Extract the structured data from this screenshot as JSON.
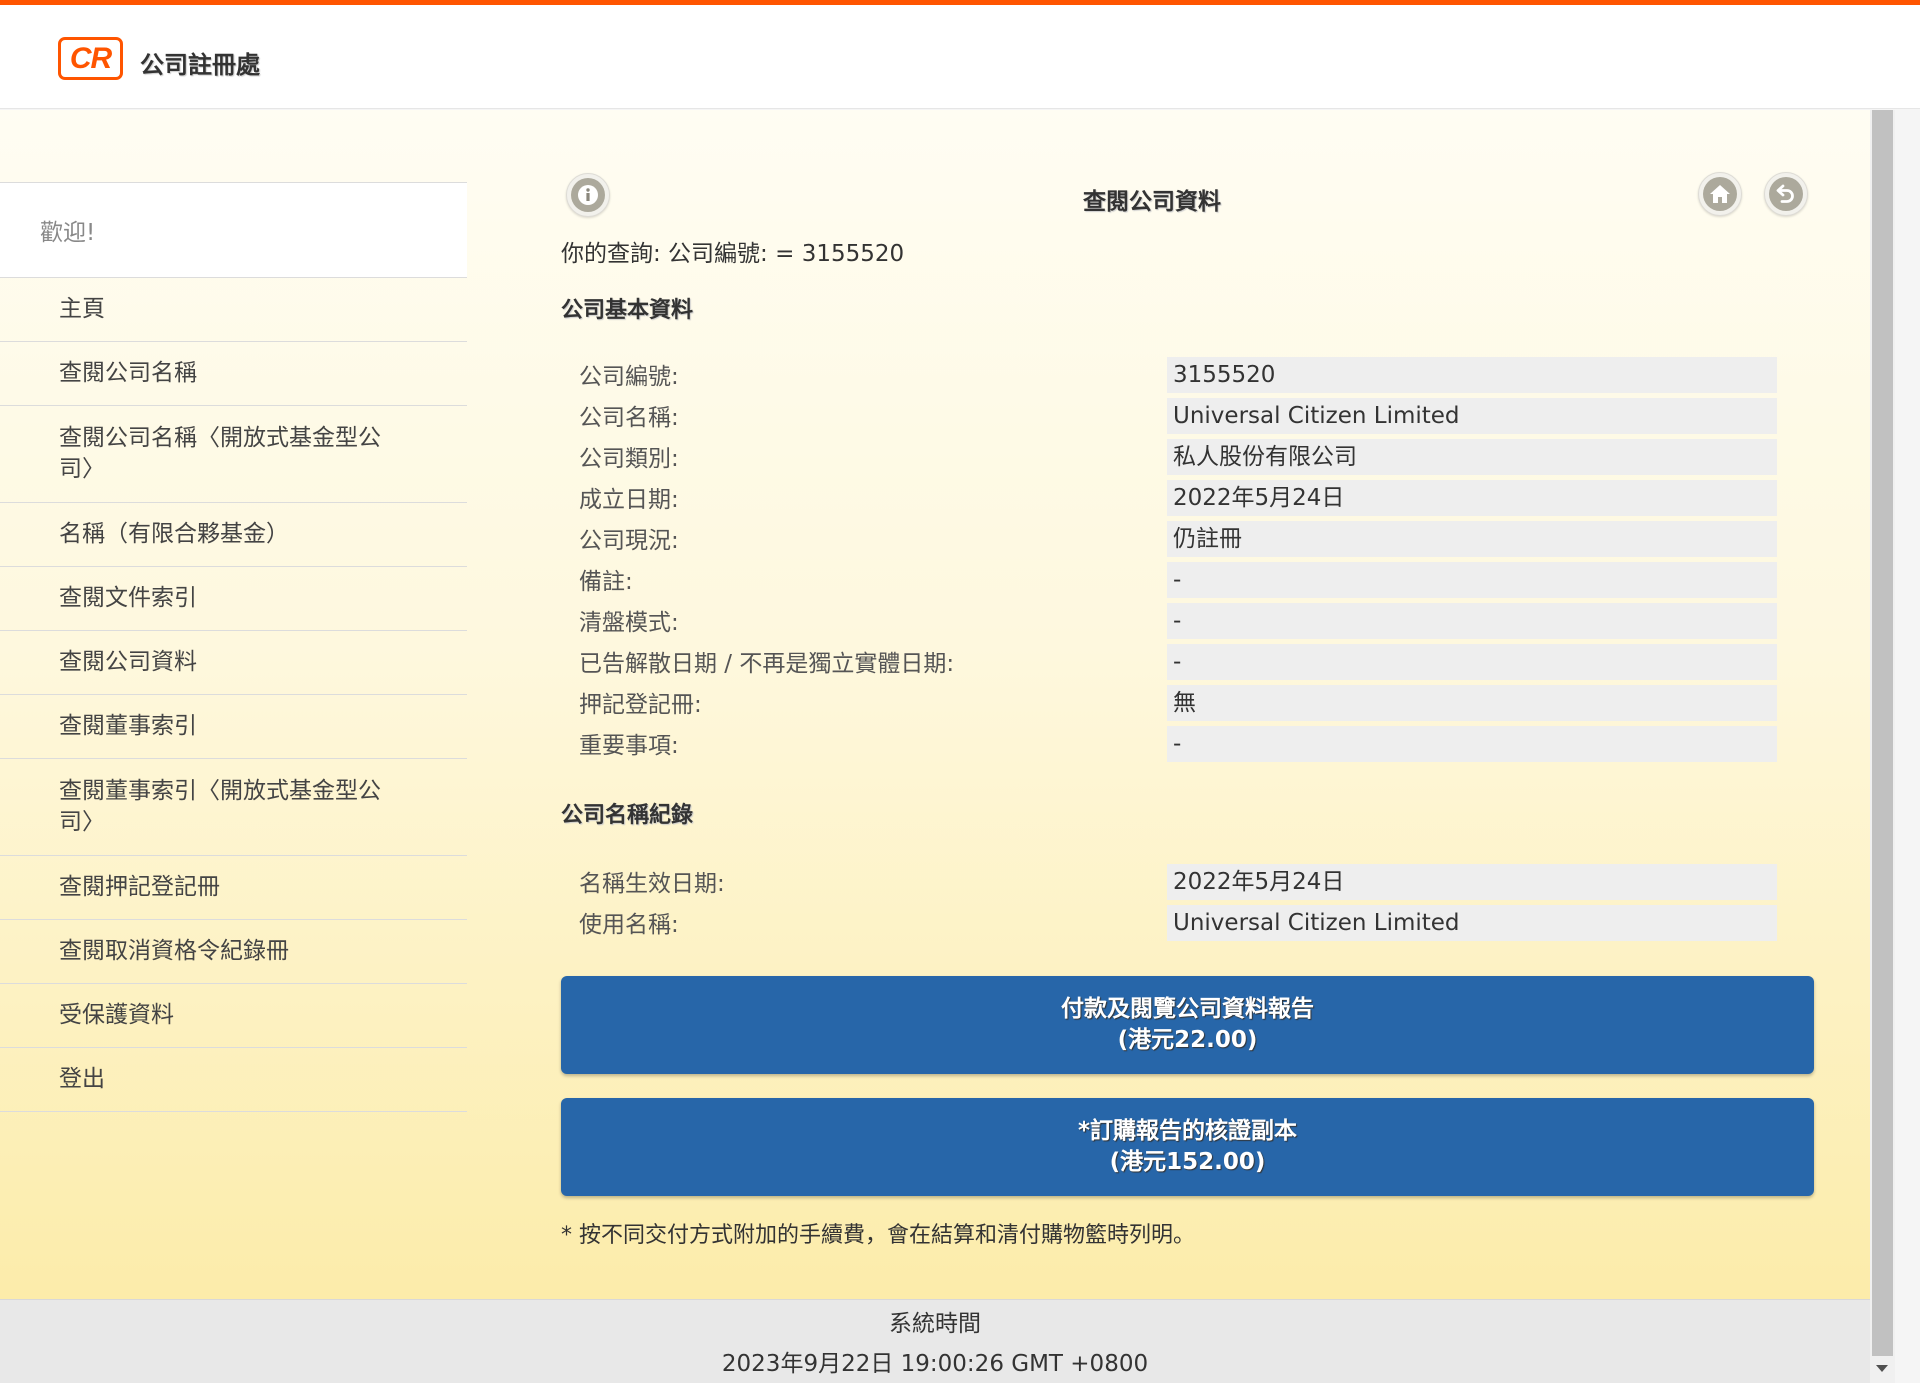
{
  "header": {
    "logo_text": "CR",
    "site_title": "公司註冊處"
  },
  "sidebar": {
    "welcome": "歡迎!",
    "items": [
      {
        "label": "主頁"
      },
      {
        "label": "查閱公司名稱"
      },
      {
        "label": "查閱公司名稱〈開放式基金型公司〉"
      },
      {
        "label": "名稱（有限合夥基金）"
      },
      {
        "label": "查閱文件索引"
      },
      {
        "label": "查閱公司資料"
      },
      {
        "label": "查閱董事索引"
      },
      {
        "label": "查閱董事索引〈開放式基金型公司〉"
      },
      {
        "label": "查閱押記登記冊"
      },
      {
        "label": "查閱取消資格令紀錄冊"
      },
      {
        "label": "受保護資料"
      },
      {
        "label": "登出"
      }
    ]
  },
  "main": {
    "title": "查閱公司資料",
    "icons": {
      "info": "info-icon",
      "home": "home-icon",
      "back": "back-icon"
    },
    "query": "你的查詢:   公司編號:   = 3155520",
    "basic_section_title": "公司基本資料",
    "basic_info": [
      {
        "label": "公司編號:",
        "value": "3155520"
      },
      {
        "label": "公司名稱:",
        "value": "Universal Citizen Limited"
      },
      {
        "label": "公司類別:",
        "value": "私人股份有限公司"
      },
      {
        "label": "成立日期:",
        "value": "2022年5月24日"
      },
      {
        "label": "公司現況:",
        "value": "仍註冊"
      },
      {
        "label": "備註:",
        "value": "-"
      },
      {
        "label": "清盤模式:",
        "value": "-"
      },
      {
        "label": "已告解散日期 / 不再是獨立實體日期:",
        "value": "-"
      },
      {
        "label": "押記登記冊:",
        "value": "無"
      },
      {
        "label": "重要事項:",
        "value": "-"
      }
    ],
    "name_history_title": "公司名稱紀錄",
    "name_history": [
      {
        "label": "名稱生效日期:",
        "value": "2022年5月24日"
      },
      {
        "label": "使用名稱:",
        "value": "Universal Citizen Limited"
      }
    ],
    "buttons": [
      {
        "line1": "付款及閱覽公司資料報告",
        "line2": "(港元22.00)"
      },
      {
        "line1": "*訂購報告的核證副本",
        "line2": "(港元152.00)"
      }
    ],
    "note": "* 按不同交付方式附加的手續費，會在結算和清付購物籃時列明。"
  },
  "footer": {
    "label": "系統時間",
    "time": "2023年9月22日 19:00:26 GMT +0800"
  },
  "colors": {
    "brand_orange": "#ff5500",
    "button_blue": "#2766a9"
  }
}
